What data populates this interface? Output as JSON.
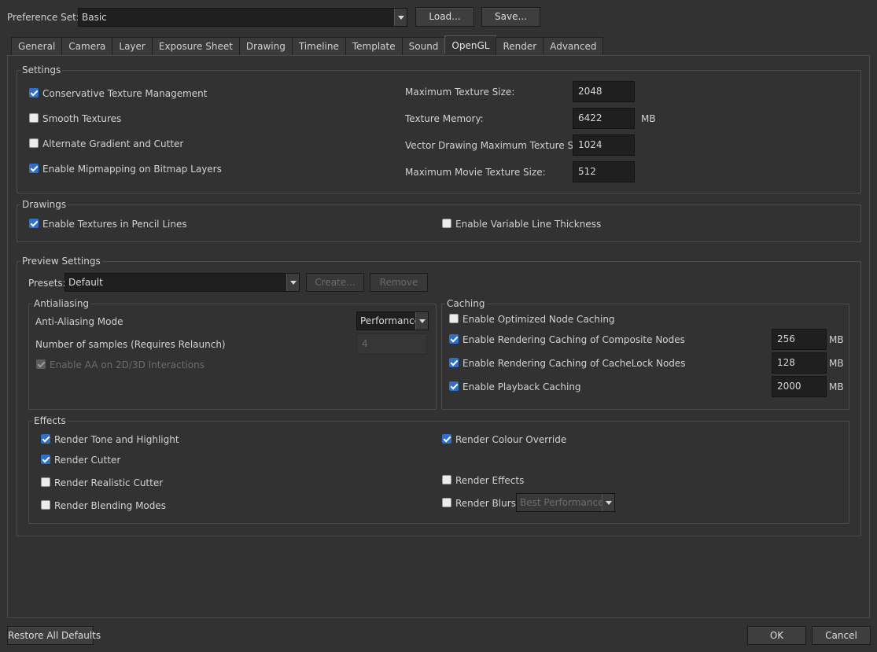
{
  "header": {
    "preference_set_label": "Preference Set:",
    "preference_set_value": "Basic",
    "load_button": "Load...",
    "save_button": "Save..."
  },
  "tabs": [
    {
      "label": "General"
    },
    {
      "label": "Camera"
    },
    {
      "label": "Layer"
    },
    {
      "label": "Exposure Sheet"
    },
    {
      "label": "Drawing"
    },
    {
      "label": "Timeline"
    },
    {
      "label": "Template"
    },
    {
      "label": "Sound"
    },
    {
      "label": "OpenGL",
      "active": true
    },
    {
      "label": "Render"
    },
    {
      "label": "Advanced"
    }
  ],
  "settings": {
    "title": "Settings",
    "conservative_texture": {
      "label": "Conservative Texture Management",
      "checked": true
    },
    "smooth_textures": {
      "label": "Smooth Textures",
      "checked": false
    },
    "alternate_gradient": {
      "label": "Alternate Gradient and Cutter",
      "checked": false
    },
    "enable_mipmapping": {
      "label": "Enable Mipmapping on Bitmap Layers",
      "checked": true
    },
    "max_texture_size": {
      "label": "Maximum Texture Size:",
      "value": "2048"
    },
    "texture_memory": {
      "label": "Texture Memory:",
      "value": "6422",
      "unit": "MB"
    },
    "vector_max_texture": {
      "label": "Vector Drawing Maximum Texture Size :",
      "value": "1024"
    },
    "max_movie_texture": {
      "label": "Maximum Movie Texture Size:",
      "value": "512"
    }
  },
  "drawings": {
    "title": "Drawings",
    "textures_pencil": {
      "label": "Enable Textures in Pencil Lines",
      "checked": true
    },
    "variable_thickness": {
      "label": "Enable Variable Line Thickness",
      "checked": false
    }
  },
  "preview": {
    "title": "Preview Settings",
    "presets_label": "Presets:",
    "presets_value": "Default",
    "create_button": "Create...",
    "remove_button": "Remove",
    "antialiasing": {
      "title": "Antialiasing",
      "mode_label": "Anti-Aliasing Mode",
      "mode_value": "Performance",
      "samples_label": "Number of samples (Requires Relaunch)",
      "samples_value": "4",
      "aa_interactions": {
        "label": "Enable AA on 2D/3D Interactions",
        "checked": true,
        "disabled": true
      }
    },
    "caching": {
      "title": "Caching",
      "optimized_node": {
        "label": "Enable Optimized Node Caching",
        "checked": false
      },
      "composite_nodes": {
        "label": "Enable Rendering Caching of Composite Nodes",
        "checked": true,
        "value": "256",
        "unit": "MB"
      },
      "cachelock_nodes": {
        "label": "Enable Rendering Caching of CacheLock Nodes",
        "checked": true,
        "value": "128",
        "unit": "MB"
      },
      "playback": {
        "label": "Enable Playback Caching",
        "checked": true,
        "value": "2000",
        "unit": "MB"
      }
    },
    "effects": {
      "title": "Effects",
      "tone_highlight": {
        "label": "Render Tone and Highlight",
        "checked": true
      },
      "cutter": {
        "label": "Render Cutter",
        "checked": true
      },
      "realistic_cutter": {
        "label": "Render Realistic Cutter",
        "checked": false
      },
      "blending_modes": {
        "label": "Render Blending Modes",
        "checked": false
      },
      "colour_override": {
        "label": "Render Colour Override",
        "checked": true
      },
      "render_effects": {
        "label": "Render Effects",
        "checked": false
      },
      "render_blurs": {
        "label": "Render Blurs",
        "checked": false
      },
      "blurs_mode": "Best Performance"
    }
  },
  "footer": {
    "restore_button": "Restore All Defaults",
    "ok_button": "OK",
    "cancel_button": "Cancel"
  },
  "colors": {
    "background": "#323232",
    "checkbox_accent": "#2f6fce",
    "field_bg": "#1f1f1f"
  }
}
